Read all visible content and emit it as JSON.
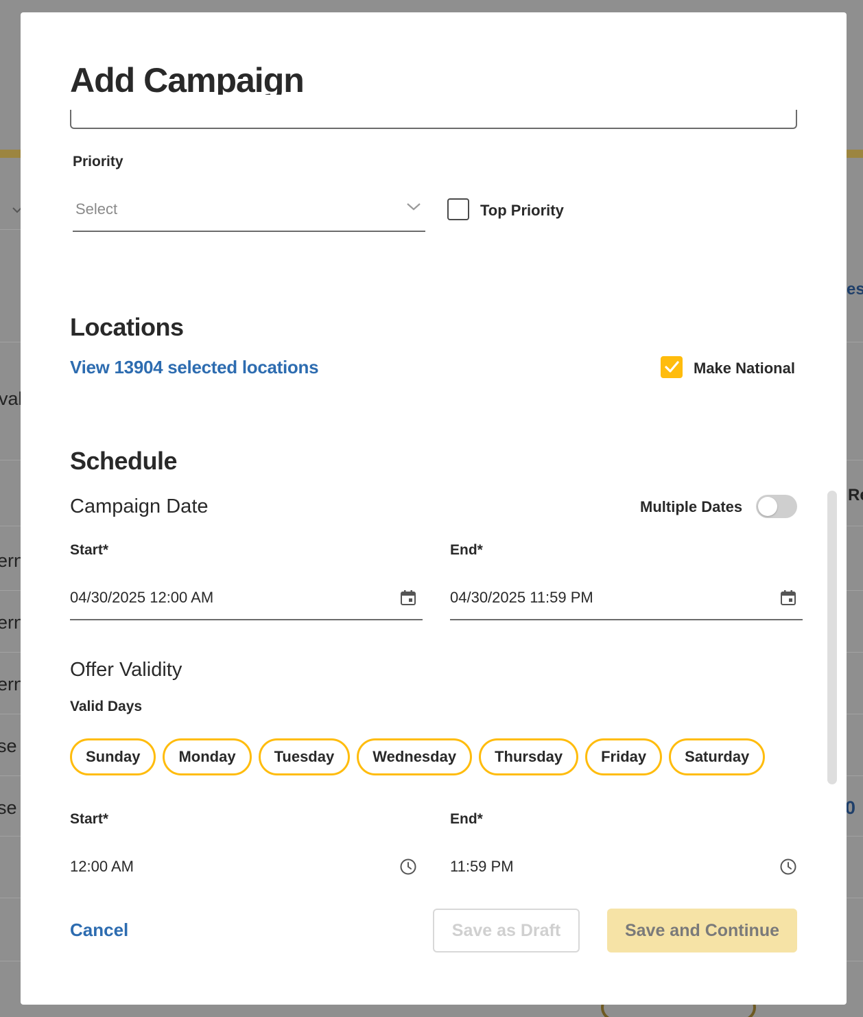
{
  "background": {
    "fragments": [
      "est",
      "val",
      "ern",
      "ern",
      "ern",
      "se",
      "se",
      "Re",
      "0"
    ]
  },
  "modal": {
    "title": "Add Campaign",
    "priority": {
      "label": "Priority",
      "select_placeholder": "Select",
      "top_priority_label": "Top Priority",
      "top_priority_checked": false
    },
    "locations": {
      "heading": "Locations",
      "view_link": "View 13904 selected locations",
      "make_national_label": "Make National",
      "make_national_checked": true
    },
    "schedule": {
      "heading": "Schedule",
      "campaign_date_label": "Campaign Date",
      "multiple_dates_label": "Multiple Dates",
      "multiple_dates_on": false,
      "start_label": "Start*",
      "start_value": "04/30/2025  12:00 AM",
      "end_label": "End*",
      "end_value": "04/30/2025  11:59 PM",
      "offer_validity_label": "Offer Validity",
      "valid_days_label": "Valid Days",
      "days": [
        "Sunday",
        "Monday",
        "Tuesday",
        "Wednesday",
        "Thursday",
        "Friday",
        "Saturday"
      ],
      "time_start_label": "Start*",
      "time_start_value": "12:00 AM",
      "time_end_label": "End*",
      "time_end_value": "11:59 PM"
    },
    "actions": {
      "cancel": "Cancel",
      "save_draft": "Save as Draft",
      "save_continue": "Save and Continue"
    }
  },
  "colors": {
    "accent": "#ffbc0d",
    "link": "#2d6cb0",
    "text": "#292929"
  }
}
